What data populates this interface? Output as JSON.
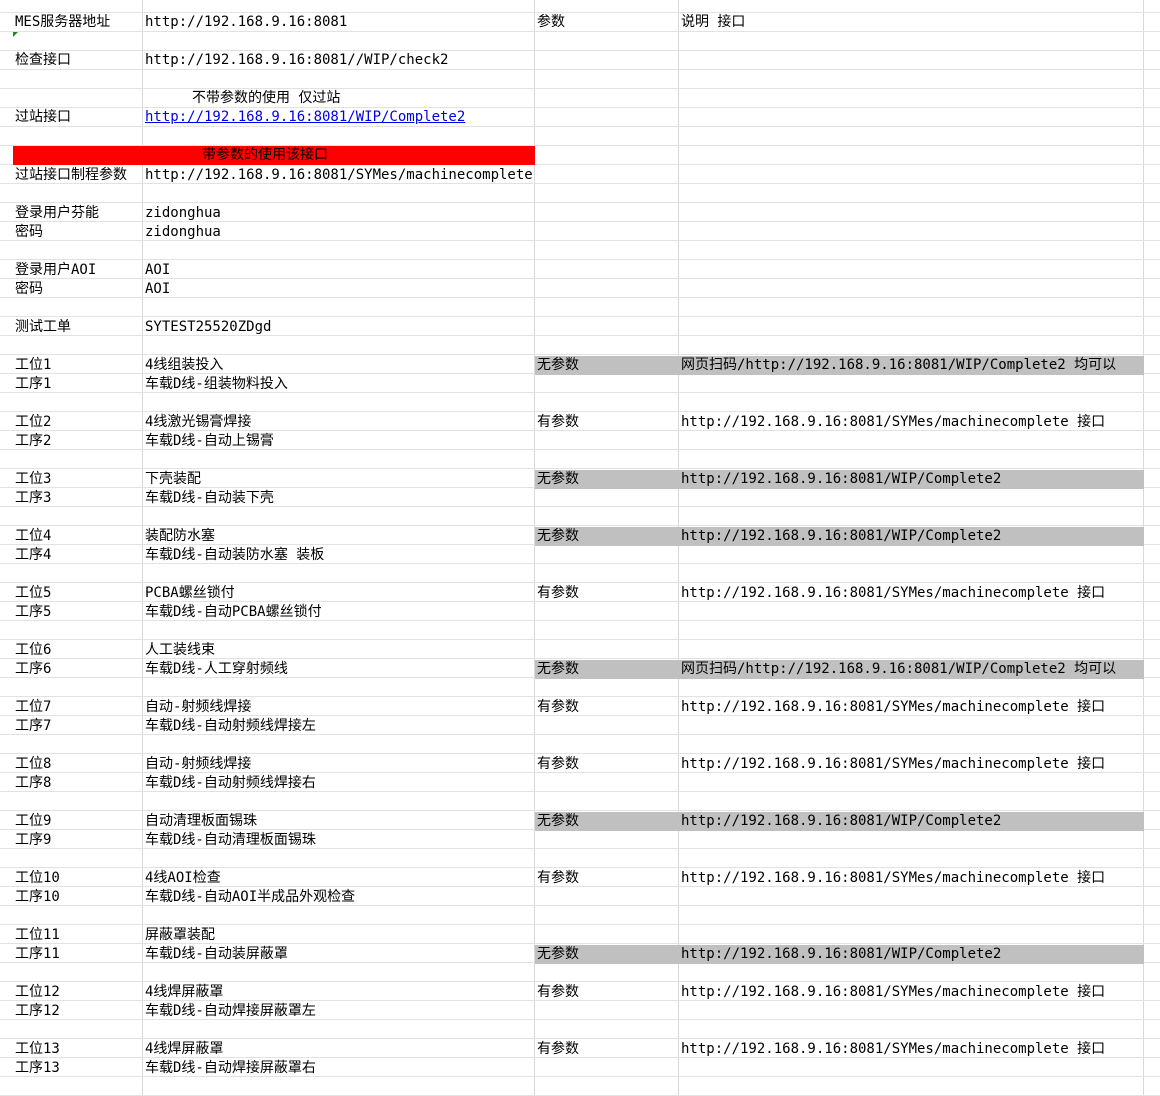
{
  "server": {
    "label": "MES服务器地址",
    "url": "http://192.168.9.16:8081",
    "param_header": "参数",
    "desc_header": "说明 接口"
  },
  "check": {
    "label": "检查接口",
    "url": "http://192.168.9.16:8081//WIP/check2"
  },
  "pass": {
    "note": "不带参数的使用 仅过站",
    "label": "过站接口",
    "url": "http://192.168.9.16:8081/WIP/Complete2"
  },
  "banner": {
    "text": "带参数的使用该接口"
  },
  "pass_param": {
    "label": "过站接口制程参数",
    "url": "http://192.168.9.16:8081/SYMes/machinecomplete"
  },
  "login1": {
    "user_label": "登录用户芬能",
    "user": "zidonghua",
    "pwd_label": "密码",
    "pwd": "zidonghua"
  },
  "login2": {
    "user_label": "登录用户AOI",
    "user": "AOI",
    "pwd_label": "密码",
    "pwd": "AOI"
  },
  "workorder": {
    "label": "测试工单",
    "value": "SYTEST25520ZDgd"
  },
  "stations": [
    {
      "station": "工位1",
      "name": "4线组装投入",
      "process": "工序1",
      "process_name": "车载D线-组装物料投入",
      "param": "无参数",
      "desc": "网页扫码/http://192.168.9.16:8081/WIP/Complete2 均可以"
    },
    {
      "station": "工位2",
      "name": "4线激光锡膏焊接",
      "process": "工序2",
      "process_name": "车载D线-自动上锡膏",
      "param": "有参数",
      "desc": "http://192.168.9.16:8081/SYMes/machinecomplete 接口"
    },
    {
      "station": "工位3",
      "name": "下壳装配",
      "process": "工序3",
      "process_name": "车载D线-自动装下壳",
      "param": "无参数",
      "desc": "http://192.168.9.16:8081/WIP/Complete2"
    },
    {
      "station": "工位4",
      "name": "装配防水塞",
      "process": "工序4",
      "process_name": "车载D线-自动装防水塞 装板",
      "param": "无参数",
      "desc": "http://192.168.9.16:8081/WIP/Complete2"
    },
    {
      "station": "工位5",
      "name": "PCBA螺丝锁付",
      "process": "工序5",
      "process_name": "车载D线-自动PCBA螺丝锁付",
      "param": "有参数",
      "desc": "http://192.168.9.16:8081/SYMes/machinecomplete 接口"
    },
    {
      "station": "工位6",
      "name": "人工装线束",
      "process": "工序6",
      "process_name": "车载D线-人工穿射频线",
      "param": "无参数",
      "desc": "网页扫码/http://192.168.9.16:8081/WIP/Complete2 均可以"
    },
    {
      "station": "工位7",
      "name": "自动-射频线焊接",
      "process": "工序7",
      "process_name": "车载D线-自动射频线焊接左",
      "param": "有参数",
      "desc": "http://192.168.9.16:8081/SYMes/machinecomplete 接口"
    },
    {
      "station": "工位8",
      "name": "自动-射频线焊接",
      "process": "工序8",
      "process_name": "车载D线-自动射频线焊接右",
      "param": "有参数",
      "desc": "http://192.168.9.16:8081/SYMes/machinecomplete 接口"
    },
    {
      "station": "工位9",
      "name": "自动清理板面锡珠",
      "process": "工序9",
      "process_name": "车载D线-自动清理板面锡珠",
      "param": "无参数",
      "desc": "http://192.168.9.16:8081/WIP/Complete2"
    },
    {
      "station": "工位10",
      "name": "4线AOI检查",
      "process": "工序10",
      "process_name": "车载D线-自动AOI半成品外观检查",
      "param": "有参数",
      "desc": "http://192.168.9.16:8081/SYMes/machinecomplete 接口"
    },
    {
      "station": "工位11",
      "name": "屏蔽罩装配",
      "process": "工序11",
      "process_name": "车载D线-自动装屏蔽罩",
      "param": "无参数",
      "desc": "http://192.168.9.16:8081/WIP/Complete2"
    },
    {
      "station": "工位12",
      "name": "4线焊屏蔽罩",
      "process": "工序12",
      "process_name": "车载D线-自动焊接屏蔽罩左",
      "param": "有参数",
      "desc": "http://192.168.9.16:8081/SYMes/machinecomplete 接口"
    },
    {
      "station": "工位13",
      "name": "4线焊屏蔽罩",
      "process": "工序13",
      "process_name": "车载D线-自动焊接屏蔽罩右",
      "param": "有参数",
      "desc": "http://192.168.9.16:8081/SYMes/machinecomplete 接口"
    }
  ]
}
